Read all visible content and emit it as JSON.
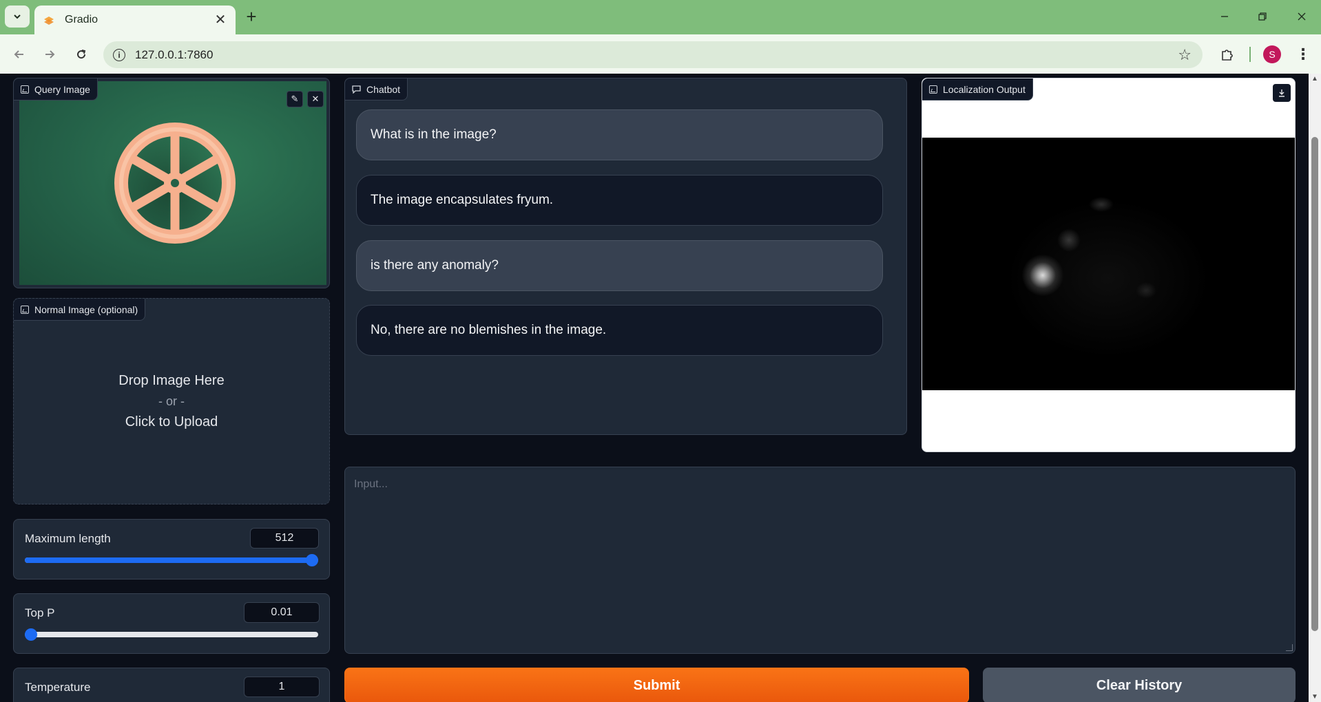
{
  "browser": {
    "tab_title": "Gradio",
    "new_tab_symbol": "+",
    "close_tab_symbol": "✕",
    "url": "127.0.0.1:7860",
    "profile_initial": "S",
    "accent_color": "#7fbd7b"
  },
  "query_image": {
    "label": "Query Image",
    "icons": [
      "image-icon",
      "edit-icon",
      "close-icon"
    ]
  },
  "normal_image": {
    "label": "Normal Image (optional)",
    "drop_text": "Drop Image Here",
    "or_text": "- or -",
    "upload_text": "Click to Upload"
  },
  "sliders": [
    {
      "label": "Maximum length",
      "value": "512",
      "fraction": 1.0
    },
    {
      "label": "Top P",
      "value": "0.01",
      "fraction": 0.0
    },
    {
      "label": "Temperature",
      "value": "1",
      "fraction": 1.0
    }
  ],
  "chatbot": {
    "label": "Chatbot",
    "messages": [
      {
        "role": "user",
        "text": "What is in the image?"
      },
      {
        "role": "bot",
        "text": "The image encapsulates fryum."
      },
      {
        "role": "user",
        "text": "is there any anomaly?"
      },
      {
        "role": "bot",
        "text": "No, there are no blemishes in the image."
      }
    ]
  },
  "localization": {
    "label": "Localization Output"
  },
  "input": {
    "placeholder": "Input..."
  },
  "buttons": {
    "submit": "Submit",
    "clear": "Clear History"
  },
  "colors": {
    "submit": "#f97316",
    "slider": "#1d6bf3",
    "background": "#0b0f19",
    "panel": "#1f2937"
  }
}
